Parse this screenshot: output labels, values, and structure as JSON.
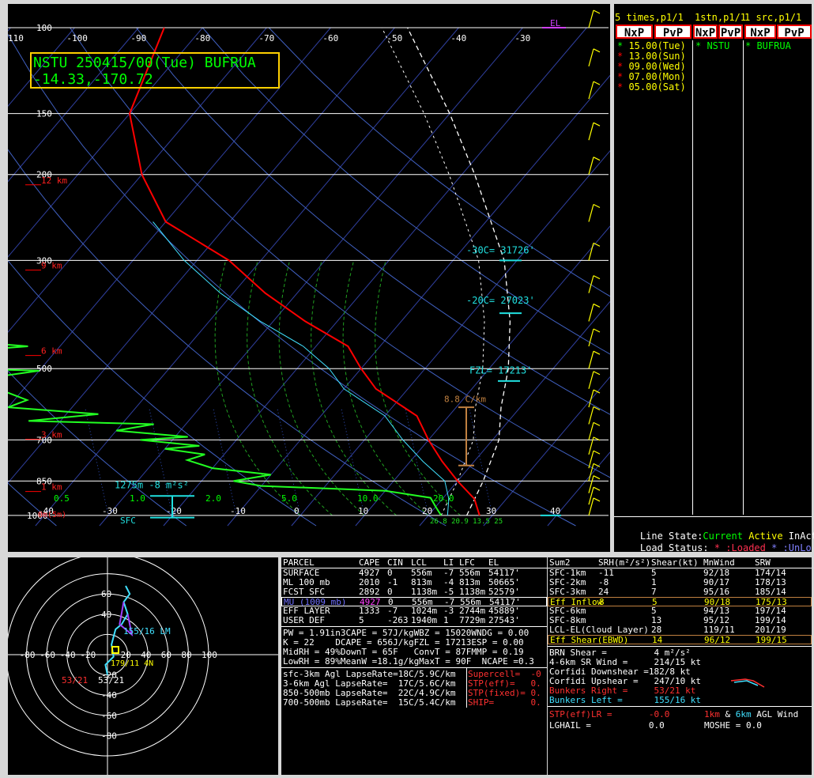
{
  "colors": {
    "bg": "#000000",
    "panel_bg": "#d8d8d8",
    "temp": "#ff0000",
    "dew": "#00ff00",
    "wetbulb": "#00e0e0",
    "white": "#ffffff",
    "yellow": "#ffff00",
    "cyan": "#00e0e0",
    "magenta": "#d040ff",
    "tan": "#c08040"
  },
  "station_box": {
    "line1": "NSTU 250415/00(Tue) BUFRUA",
    "line2": "-14.33,-170.72"
  },
  "el_label": "EL",
  "chart_data": {
    "type": "line",
    "title": "NSTU 250415/00(Tue) BUFRUA",
    "pressure_levels": [
      100,
      150,
      200,
      300,
      500,
      700,
      850,
      1000
    ],
    "pressure_labels": [
      "100",
      "150",
      "200",
      "300",
      "500",
      "700",
      "850",
      "1000"
    ],
    "temp_ticks": [
      "-110",
      "-100",
      "-90",
      "-80",
      "-70",
      "-60",
      "-50",
      "-40",
      "-30"
    ],
    "temp_tick_values": [
      -110,
      -100,
      -90,
      -80,
      -70,
      -60,
      -50,
      -40,
      -30
    ],
    "height_labels": [
      {
        "text": "12 km",
        "p": 210
      },
      {
        "text": "9 km",
        "p": 314
      },
      {
        "text": "6 km",
        "p": 470
      },
      {
        "text": "3 km",
        "p": 698
      },
      {
        "text": "1 km",
        "p": 893
      }
    ],
    "surface_label": "0m(5m)",
    "bottom_temp_labels": [
      "-40",
      "-30",
      "-20",
      "-10",
      "0",
      "10",
      "20",
      "30",
      "40"
    ],
    "bottom_temp_values": [
      -40,
      -30,
      -20,
      -10,
      0,
      10,
      20,
      30,
      40
    ],
    "mixing_labels": [
      "0.5",
      "1.0",
      "2.0",
      "5.0",
      "10.0",
      "20.0"
    ],
    "annotations": {
      "m30c": "-30C= 31726'",
      "m20c": "-20C= 27023'",
      "fzl": "FZL= 17213'",
      "lapse": "8.8 C/km",
      "effinflow": "1275m   -8 m²s²",
      "sfc": "SFC",
      "sfc_vals": "26.8 20.9 13.5 25"
    },
    "series": [
      {
        "name": "temperature",
        "points": [
          [
            28,
            1000
          ],
          [
            25,
            925
          ],
          [
            20,
            850
          ],
          [
            15,
            775
          ],
          [
            10,
            700
          ],
          [
            5,
            625
          ],
          [
            -5,
            550
          ],
          [
            -10,
            500
          ],
          [
            -15,
            450
          ],
          [
            -25,
            400
          ],
          [
            -35,
            350
          ],
          [
            -45,
            300
          ],
          [
            -60,
            250
          ],
          [
            -70,
            200
          ],
          [
            -80,
            150
          ],
          [
            -86,
            100
          ]
        ]
      },
      {
        "name": "dewpoint",
        "points": [
          [
            22,
            1000
          ],
          [
            20,
            960
          ],
          [
            18,
            920
          ],
          [
            10,
            890
          ],
          [
            -10,
            870
          ],
          [
            -15,
            850
          ],
          [
            -10,
            825
          ],
          [
            -20,
            800
          ],
          [
            -25,
            770
          ],
          [
            -23,
            750
          ],
          [
            -30,
            730
          ],
          [
            -25,
            720
          ],
          [
            -35,
            700
          ],
          [
            -28,
            690
          ],
          [
            -40,
            670
          ],
          [
            -35,
            650
          ],
          [
            -55,
            640
          ],
          [
            -45,
            620
          ],
          [
            -60,
            600
          ],
          [
            -58,
            580
          ],
          [
            -62,
            560
          ],
          [
            -65,
            540
          ],
          [
            -66,
            520
          ],
          [
            -60,
            505
          ],
          [
            -72,
            500
          ],
          [
            -70,
            480
          ],
          [
            -74,
            460
          ],
          [
            -65,
            450
          ],
          [
            -85,
            430
          ],
          [
            -78,
            420
          ],
          [
            -90,
            400
          ],
          [
            -82,
            380
          ],
          [
            -88,
            360
          ],
          [
            -86,
            340
          ],
          [
            -95,
            320
          ],
          [
            -90,
            300
          ],
          [
            -94,
            280
          ],
          [
            -96,
            250
          ],
          [
            -92,
            230
          ],
          [
            -100,
            210
          ],
          [
            -98,
            200
          ],
          [
            -102,
            180
          ],
          [
            -108,
            160
          ],
          [
            -105,
            150
          ],
          [
            -110,
            130
          ],
          [
            -112,
            110
          ],
          [
            -115,
            100
          ]
        ]
      },
      {
        "name": "wetbulb",
        "points": [
          [
            23,
            1000
          ],
          [
            21,
            925
          ],
          [
            18,
            850
          ],
          [
            12,
            775
          ],
          [
            6,
            700
          ],
          [
            0,
            625
          ],
          [
            -10,
            550
          ],
          [
            -15,
            500
          ],
          [
            -22,
            450
          ],
          [
            -32,
            400
          ],
          [
            -42,
            350
          ],
          [
            -52,
            300
          ],
          [
            -62,
            250
          ]
        ]
      }
    ],
    "parcel_dashed": [
      [
        26,
        1000
      ],
      [
        24,
        850
      ],
      [
        21,
        700
      ],
      [
        17,
        600
      ],
      [
        13,
        500
      ],
      [
        7,
        400
      ],
      [
        -2,
        300
      ],
      [
        -18,
        200
      ],
      [
        -30,
        150
      ],
      [
        -48,
        100
      ]
    ]
  },
  "hodograph": {
    "rings": [
      "20",
      "40",
      "60",
      "80",
      "100"
    ],
    "labels": {
      "lm": "155/16 LM",
      "rm": "53/21",
      "left": "53/21",
      "bn": "179/11 4N"
    }
  },
  "right_panel": {
    "headers": [
      "5 times,p1/1",
      "1stn,p1/1",
      "1 src,p1/1"
    ],
    "buttons": [
      "NxP",
      "PvP",
      "NxP",
      "PvP",
      "NxP",
      "PvP"
    ],
    "times": [
      {
        "mark": "*",
        "text": "15.00(Tue)",
        "color": "#ffff00",
        "mark_color": "#00ff00"
      },
      {
        "mark": "*",
        "text": "13.00(Sun)",
        "color": "#ffff00",
        "mark_color": "#ff0000"
      },
      {
        "mark": "*",
        "text": "09.00(Wed)",
        "color": "#ffff00",
        "mark_color": "#ff0000"
      },
      {
        "mark": "*",
        "text": "07.00(Mon)",
        "color": "#ffff00",
        "mark_color": "#ff0000"
      },
      {
        "mark": "*",
        "text": "05.00(Sat)",
        "color": "#ffff00",
        "mark_color": "#ff0000"
      }
    ],
    "stn": "* NSTU",
    "src": "* BUFRUA",
    "line_state_label": "Line State:",
    "line_state_current": "Current",
    "line_state_active": "Active",
    "line_state_inact": "InAct",
    "load_status_label": "Load Status:",
    "load_loaded": "* :Loaded",
    "load_unloaded": "* :UnLo"
  },
  "parcel_table": {
    "headers": [
      "PARCEL",
      "CAPE",
      "CIN",
      "LCL",
      "LI",
      "LFC",
      "EL"
    ],
    "rows": [
      [
        "SURFACE",
        "4927",
        "0",
        "556m",
        "-7",
        "556m",
        "54117'"
      ],
      [
        "ML 100 mb",
        "2010",
        "-1",
        "813m",
        "-4",
        "813m",
        "50665'"
      ],
      [
        "FCST SFC",
        "2892",
        "0",
        "1138m",
        "-5",
        "1138m",
        "52579'"
      ],
      [
        "MU (1009 mb)",
        "4927",
        "0",
        "556m",
        "-7",
        "556m",
        "54117'"
      ],
      [
        "EFF LAYER",
        "1333",
        "-7",
        "1024m",
        "-3",
        "2744m",
        "45889'"
      ],
      [
        "USER DEF",
        "5",
        "-263",
        "1940m",
        "1",
        "7729m",
        "27543'"
      ]
    ],
    "extra": [
      "PW = 1.91in3CAPE = 57J/kgWBZ = 15020WNDG = 0.00",
      "K = 22    DCAPE = 656J/kgFZL = 17213ESP = 0.00",
      "MidRH = 49%DownT = 65F   ConvT = 87FMMP = 0.19",
      "LowRH = 89%MeanW =18.1g/kgMaxT = 90F  NCAPE =0.3"
    ],
    "lapse": [
      "sfc-3km Agl LapseRate=18C/5.9C/km",
      "3-6km Agl LapseRate=  17C/5.6C/km",
      "850-500mb LapseRate=  22C/4.9C/km",
      "700-500mb LapseRate=  15C/5.4C/km"
    ],
    "params": [
      "Supercell=  -0",
      "STP(eff)=   0.",
      "STP(fixed)= 0.",
      "SHIP=       0."
    ]
  },
  "shear_table": {
    "headers": [
      "Sum2",
      "SRH(m²/s²)",
      "Shear(kt)",
      "MnWind",
      "SRW"
    ],
    "rows": [
      [
        "SFC-1km",
        "-11",
        "5",
        "92/18",
        "174/14"
      ],
      [
        "SFC-2km",
        "-8",
        "1",
        "90/17",
        "178/13"
      ],
      [
        "SFC-3km",
        "24",
        "7",
        "95/16",
        "185/14"
      ],
      [
        "Eff Inflow",
        "8",
        "5",
        "90/18",
        "175/13"
      ],
      [
        "SFC-6km",
        "",
        "5",
        "94/13",
        "197/14"
      ],
      [
        "SFC-8km",
        "",
        "13",
        "95/12",
        "199/14"
      ],
      [
        "LCL-EL(Cloud Layer)",
        "",
        "28",
        "119/11",
        "201/19"
      ],
      [
        "Eff Shear(EBWD)",
        "",
        "14",
        "96/12",
        "199/15"
      ]
    ],
    "misc": [
      "BRN Shear =         4 m²/s²",
      "4-6km SR Wind =     214/15 kt",
      "Corfidi Downshear =182/8 kt",
      "Corfidi Upshear =   247/10 kt",
      "Bunkers Right =     53/21 kt",
      "Bunkers Left =      155/16 kt"
    ],
    "stp_lr": "STP(eff)LR =       -0.0",
    "wind_legend": "1km & 6km AGL Wind",
    "wind_1km": "1km",
    "wind_6km": "6km",
    "lghail": "LGHAIL =           0.0",
    "moshe": "MOSHE = 0.0"
  }
}
